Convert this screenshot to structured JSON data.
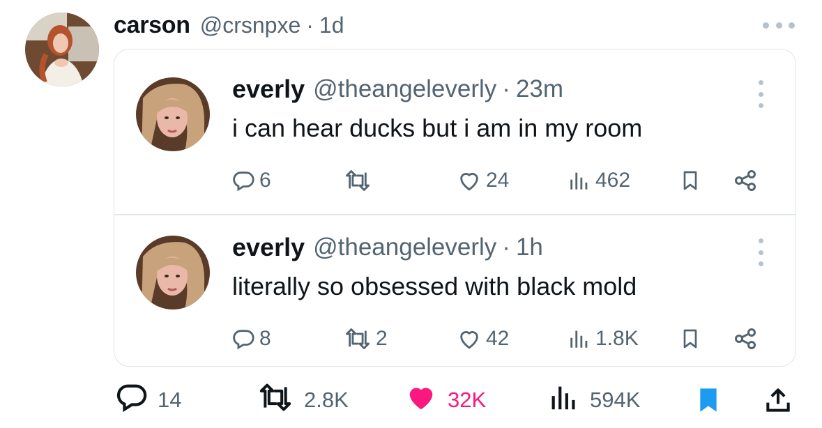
{
  "post": {
    "author": {
      "name": "carson",
      "handle": "@crsnpxe",
      "time": "1d"
    },
    "quoted": [
      {
        "name": "everly",
        "handle": "@theangeleverly",
        "time": "23m",
        "text": "i can hear ducks but i am in my room",
        "replies": "6",
        "reposts": "",
        "likes": "24",
        "views": "462"
      },
      {
        "name": "everly",
        "handle": "@theangeleverly",
        "time": "1h",
        "text": "literally so obsessed with black mold",
        "replies": "8",
        "reposts": "2",
        "likes": "42",
        "views": "1.8K"
      }
    ],
    "stats": {
      "replies": "14",
      "reposts": "2.8K",
      "likes": "32K",
      "views": "594K"
    }
  },
  "colors": {
    "text": "#0f1419",
    "secondary": "#536471",
    "like": "#f91880",
    "bookmark": "#1d9bf0",
    "border": "#dde3e8"
  },
  "icons": {
    "reply": "reply-icon",
    "repost": "repost-icon",
    "like": "heart-icon",
    "views": "views-icon",
    "bookmark": "bookmark-icon",
    "share": "share-icon",
    "more": "more-icon"
  }
}
